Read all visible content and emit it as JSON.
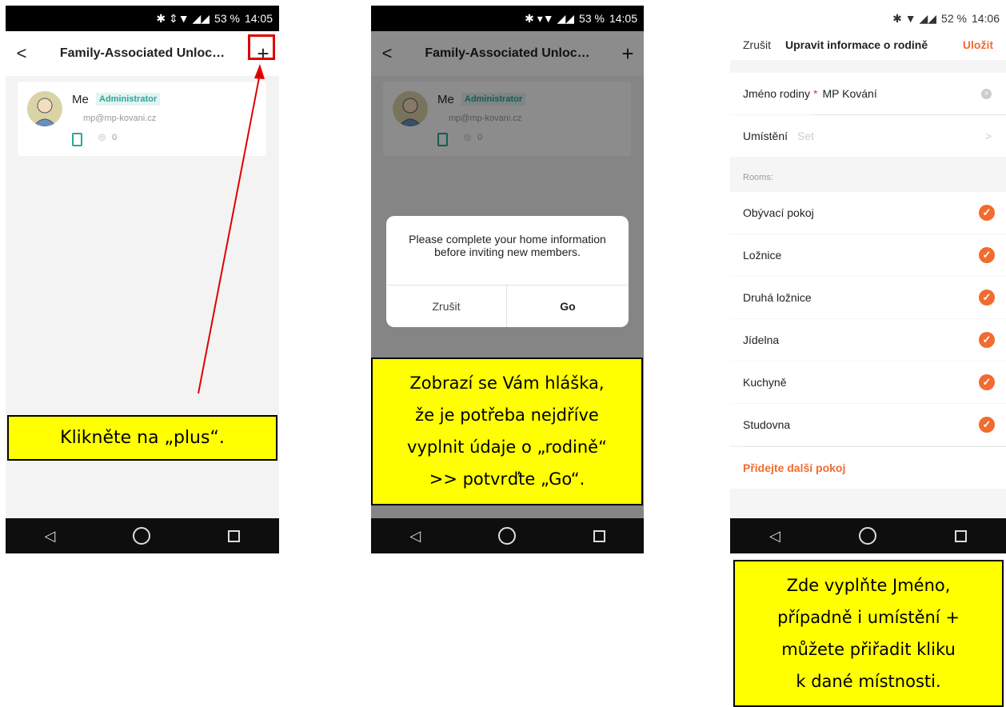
{
  "phone1": {
    "status": {
      "icons": "✱ ⇕▼ ◢◢",
      "battery": "53 %",
      "time": "14:05"
    },
    "header": {
      "title": "Family-Associated Unloc…",
      "back": "<",
      "add": "+"
    },
    "member": {
      "name": "Me",
      "role": "Administrator",
      "email": "mp@mp-kovani.cz",
      "fingerprint_count": "0"
    },
    "callout": "Klikněte na „plus“."
  },
  "phone2": {
    "status": {
      "icons": "✱ ▾▼ ◢◢",
      "battery": "53 %",
      "time": "14:05"
    },
    "header": {
      "title": "Family-Associated Unloc…",
      "back": "<",
      "add": "+"
    },
    "member": {
      "name": "Me",
      "role": "Administrator",
      "email": "mp@mp-kovani.cz",
      "fingerprint_count": "0"
    },
    "dialog": {
      "message": "Please complete your home information before inviting new members.",
      "cancel": "Zrušit",
      "confirm": "Go"
    },
    "callout": [
      "Zobrazí se Vám hláška,",
      "že je potřeba nejdříve",
      "vyplnit údaje o „rodině“",
      ">> potvrďte „Go“."
    ]
  },
  "phone3": {
    "status": {
      "icons": "✱ ▼ ◢◢",
      "battery": "52 %",
      "time": "14:06"
    },
    "header": {
      "cancel": "Zrušit",
      "title": "Upravit informace o rodině",
      "save": "Uložit"
    },
    "family_name": {
      "label": "Jméno rodiny",
      "required": "*",
      "value": "MP Kování"
    },
    "location": {
      "label": "Umístění",
      "placeholder": "Set",
      "chevron": ">"
    },
    "rooms_label": "Rooms:",
    "rooms": [
      "Obývací pokoj",
      "Ložnice",
      "Druhá ložnice",
      "Jídelna",
      "Kuchyně",
      "Studovna"
    ],
    "add_room": "Přidejte další pokoj",
    "accent": "#f26b2f"
  },
  "callout3": [
    "Zde vyplňte Jméno,",
    "případně i umístění +",
    "můžete přiřadit kliku",
    "k dané místnosti."
  ]
}
